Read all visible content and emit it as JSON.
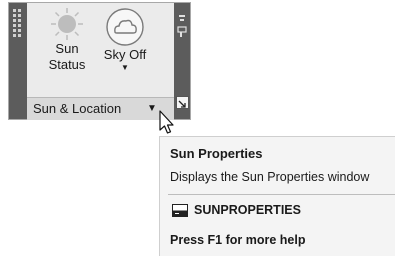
{
  "panel": {
    "tools": [
      {
        "label_line1": "Sun",
        "label_line2": "Status",
        "icon": "sun-icon"
      },
      {
        "label": "Sky Off",
        "icon": "cloud-icon",
        "has_dropdown": true
      }
    ],
    "footer_label": "Sun & Location",
    "footer_caret": "▼",
    "dropdown_caret": "▼",
    "colors": {
      "panel_bg": "#ebebeb",
      "grip": "#5c5c5c",
      "footer_bg": "#d9d9d9"
    }
  },
  "tooltip": {
    "title": "Sun Properties",
    "description": "Displays the Sun Properties window",
    "command": "SUNPROPERTIES",
    "command_icon": "command-line-icon",
    "help": "Press F1 for more help"
  }
}
